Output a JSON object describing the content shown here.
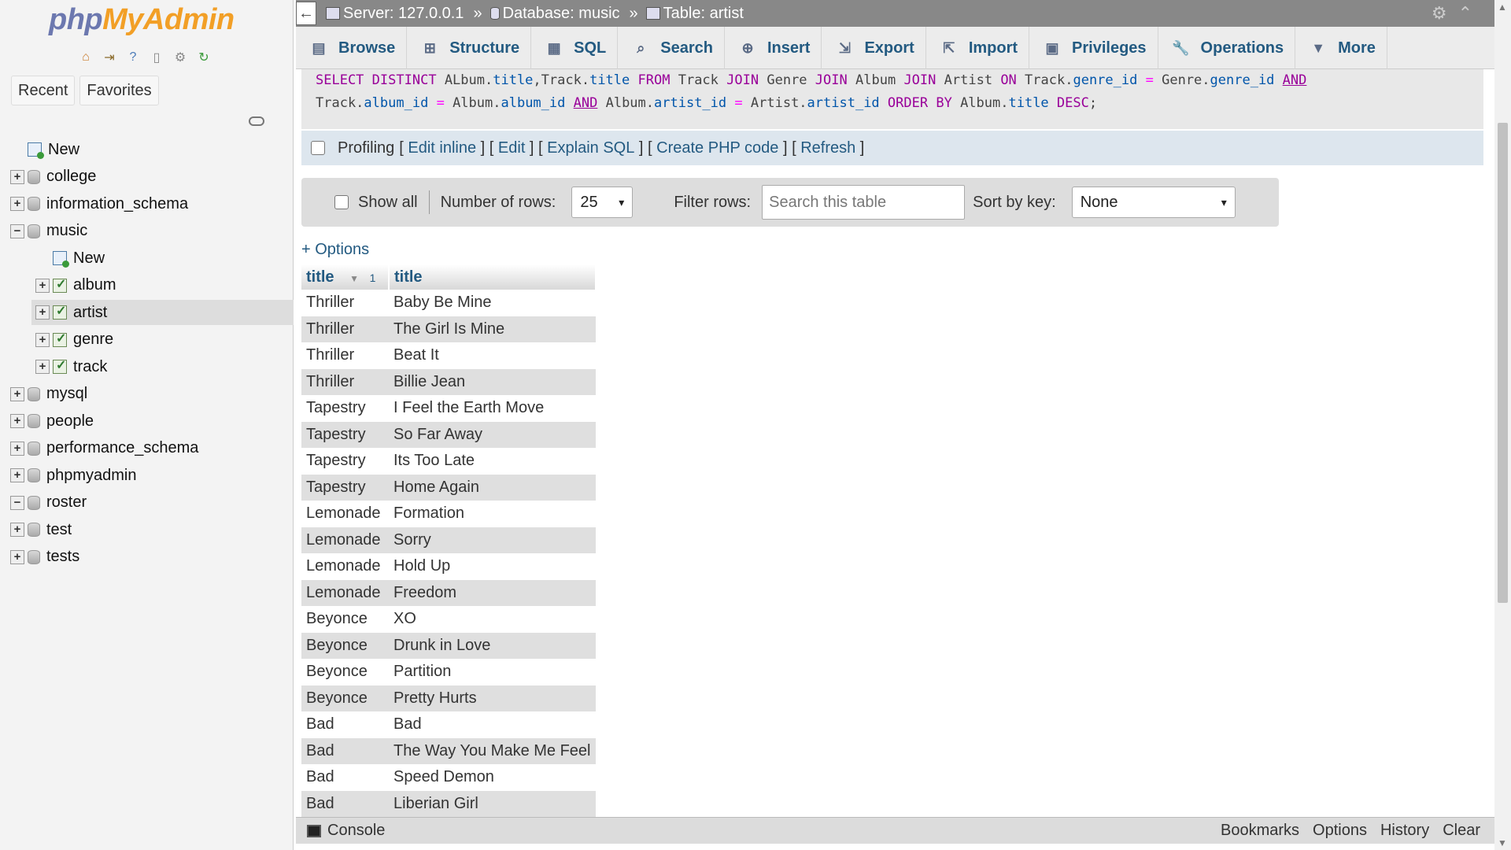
{
  "sidebar": {
    "logo_php": "php",
    "logo_myadmin": "MyAdmin",
    "recent_label": "Recent",
    "favorites_label": "Favorites",
    "tree": [
      {
        "label": "New",
        "level": 0,
        "kind": "new",
        "expander": "none"
      },
      {
        "label": "college",
        "level": 0,
        "kind": "db",
        "expander": "+"
      },
      {
        "label": "information_schema",
        "level": 0,
        "kind": "db",
        "expander": "+"
      },
      {
        "label": "music",
        "level": 0,
        "kind": "db",
        "expander": "−"
      },
      {
        "label": "New",
        "level": 1,
        "kind": "new",
        "expander": "none"
      },
      {
        "label": "album",
        "level": 1,
        "kind": "table",
        "expander": "+"
      },
      {
        "label": "artist",
        "level": 1,
        "kind": "table",
        "expander": "+",
        "selected": true
      },
      {
        "label": "genre",
        "level": 1,
        "kind": "table",
        "expander": "+"
      },
      {
        "label": "track",
        "level": 1,
        "kind": "table",
        "expander": "+"
      },
      {
        "label": "mysql",
        "level": 0,
        "kind": "db",
        "expander": "+"
      },
      {
        "label": "people",
        "level": 0,
        "kind": "db",
        "expander": "+"
      },
      {
        "label": "performance_schema",
        "level": 0,
        "kind": "db",
        "expander": "+"
      },
      {
        "label": "phpmyadmin",
        "level": 0,
        "kind": "db",
        "expander": "+"
      },
      {
        "label": "roster",
        "level": 0,
        "kind": "db",
        "expander": "−"
      },
      {
        "label": "test",
        "level": 0,
        "kind": "db",
        "expander": "+"
      },
      {
        "label": "tests",
        "level": 0,
        "kind": "db",
        "expander": "+"
      }
    ]
  },
  "breadcrumb": {
    "server": "Server: 127.0.0.1",
    "database": "Database: music",
    "table": "Table: artist",
    "sep": "»"
  },
  "tabs": [
    {
      "label": "Browse",
      "icon": "browse-icon",
      "glyph": "▤"
    },
    {
      "label": "Structure",
      "icon": "structure-icon",
      "glyph": "⊞"
    },
    {
      "label": "SQL",
      "icon": "sql-icon",
      "glyph": "▦"
    },
    {
      "label": "Search",
      "icon": "search-icon",
      "glyph": "⌕"
    },
    {
      "label": "Insert",
      "icon": "insert-icon",
      "glyph": "⊕"
    },
    {
      "label": "Export",
      "icon": "export-icon",
      "glyph": "⇲"
    },
    {
      "label": "Import",
      "icon": "import-icon",
      "glyph": "⇱"
    },
    {
      "label": "Privileges",
      "icon": "privileges-icon",
      "glyph": "▣"
    },
    {
      "label": "Operations",
      "icon": "wrench-icon",
      "glyph": "🔧"
    },
    {
      "label": "More",
      "icon": "chevron-down-icon",
      "glyph": "▼"
    }
  ],
  "sql": {
    "select": "SELECT",
    "distinct": "DISTINCT",
    "p1": "ALbum.",
    "f_title1": "title",
    "p2": ",Track.",
    "f_title2": "title",
    "from": "FROM",
    "t_track": "Track",
    "join1": "JOIN",
    "t_genre": "Genre",
    "join2": "JOIN",
    "t_album": "Album",
    "join3": "JOIN",
    "t_artist": "Artist",
    "on": "ON",
    "p3": "Track.",
    "f_genre_id1": "genre_id",
    "eq1": "=",
    "p4": "Genre.",
    "f_genre_id2": "genre_id",
    "and1": "AND",
    "p5": "Track.",
    "f_album_id1": "album_id",
    "eq2": "=",
    "p6": "Album.",
    "f_album_id2": "album_id",
    "and2": "AND",
    "p7": "Album.",
    "f_artist_id1": "artist_id",
    "eq3": "=",
    "p8": "Artist.",
    "f_artist_id2": "artist_id",
    "order": "ORDER BY",
    "p9": "Album.",
    "f_title3": "title",
    "desc": "DESC",
    "end": ";"
  },
  "profiling": {
    "label": "Profiling",
    "edit_inline": "Edit inline",
    "edit": "Edit",
    "explain": "Explain SQL",
    "create_php": "Create PHP code",
    "refresh": "Refresh"
  },
  "nav": {
    "show_all": "Show all",
    "rows_label": "Number of rows:",
    "rows_value": "25",
    "filter_label": "Filter rows:",
    "filter_placeholder": "Search this table",
    "sort_label": "Sort by key:",
    "sort_value": "None"
  },
  "options_link": "+ Options",
  "results": {
    "headers": [
      {
        "label": "title",
        "sort_marker": "1"
      },
      {
        "label": "title"
      }
    ],
    "rows": [
      [
        "Thriller",
        "Baby Be Mine"
      ],
      [
        "Thriller",
        "The Girl Is Mine"
      ],
      [
        "Thriller",
        "Beat It"
      ],
      [
        "Thriller",
        "Billie Jean"
      ],
      [
        "Tapestry",
        "I Feel the Earth Move"
      ],
      [
        "Tapestry",
        "So Far Away"
      ],
      [
        "Tapestry",
        "Its Too Late"
      ],
      [
        "Tapestry",
        "Home Again"
      ],
      [
        "Lemonade",
        "Formation"
      ],
      [
        "Lemonade",
        "Sorry"
      ],
      [
        "Lemonade",
        "Hold Up"
      ],
      [
        "Lemonade",
        "Freedom"
      ],
      [
        "Beyonce",
        "XO"
      ],
      [
        "Beyonce",
        "Drunk in Love"
      ],
      [
        "Beyonce",
        "Partition"
      ],
      [
        "Beyonce",
        "Pretty Hurts"
      ],
      [
        "Bad",
        "Bad"
      ],
      [
        "Bad",
        "The Way You Make Me Feel"
      ],
      [
        "Bad",
        "Speed Demon"
      ],
      [
        "Bad",
        "Liberian Girl"
      ]
    ]
  },
  "console": {
    "label": "Console",
    "links": [
      "Bookmarks",
      "Options",
      "History",
      "Clear"
    ]
  },
  "colors": {
    "link": "#235a81",
    "keyword": "#990099",
    "field": "#0055aa",
    "logo_php": "#6c78af",
    "logo_myadmin": "#f29f26"
  }
}
